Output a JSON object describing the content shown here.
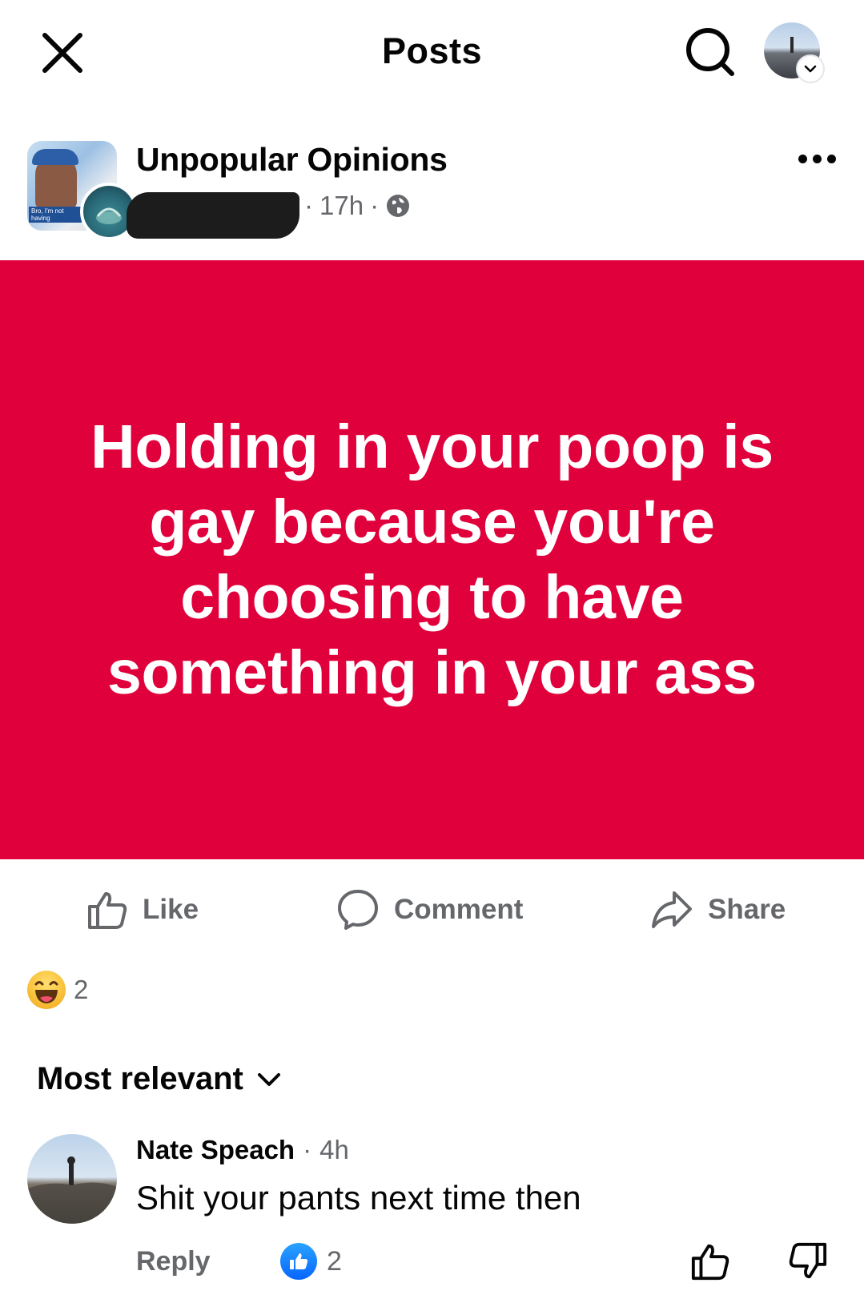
{
  "topbar": {
    "title": "Posts",
    "close_icon": "close-icon",
    "search_icon": "search-icon",
    "profile_icon": "profile-avatar"
  },
  "post": {
    "group_name": "Unpopular Opinions",
    "time": "17h",
    "separator": "·",
    "audience_icon": "globe-icon",
    "avatar_caption": "Bro, I'm not having",
    "text": "Holding in your poop is gay because you're choosing to have something in your ass",
    "background_color": "#e0003b"
  },
  "actions": {
    "like": "Like",
    "comment": "Comment",
    "share": "Share"
  },
  "reactions": {
    "emoji": "haha",
    "count": "2"
  },
  "sort": {
    "label": "Most relevant"
  },
  "comment": {
    "author": "Nate Speach",
    "separator": "·",
    "time": "4h",
    "text": "Shit your pants next time then",
    "reply": "Reply",
    "like_count": "2"
  },
  "colors": {
    "accent_blue": "#0866ff",
    "muted_text": "#65676b",
    "post_red": "#e0003b"
  }
}
